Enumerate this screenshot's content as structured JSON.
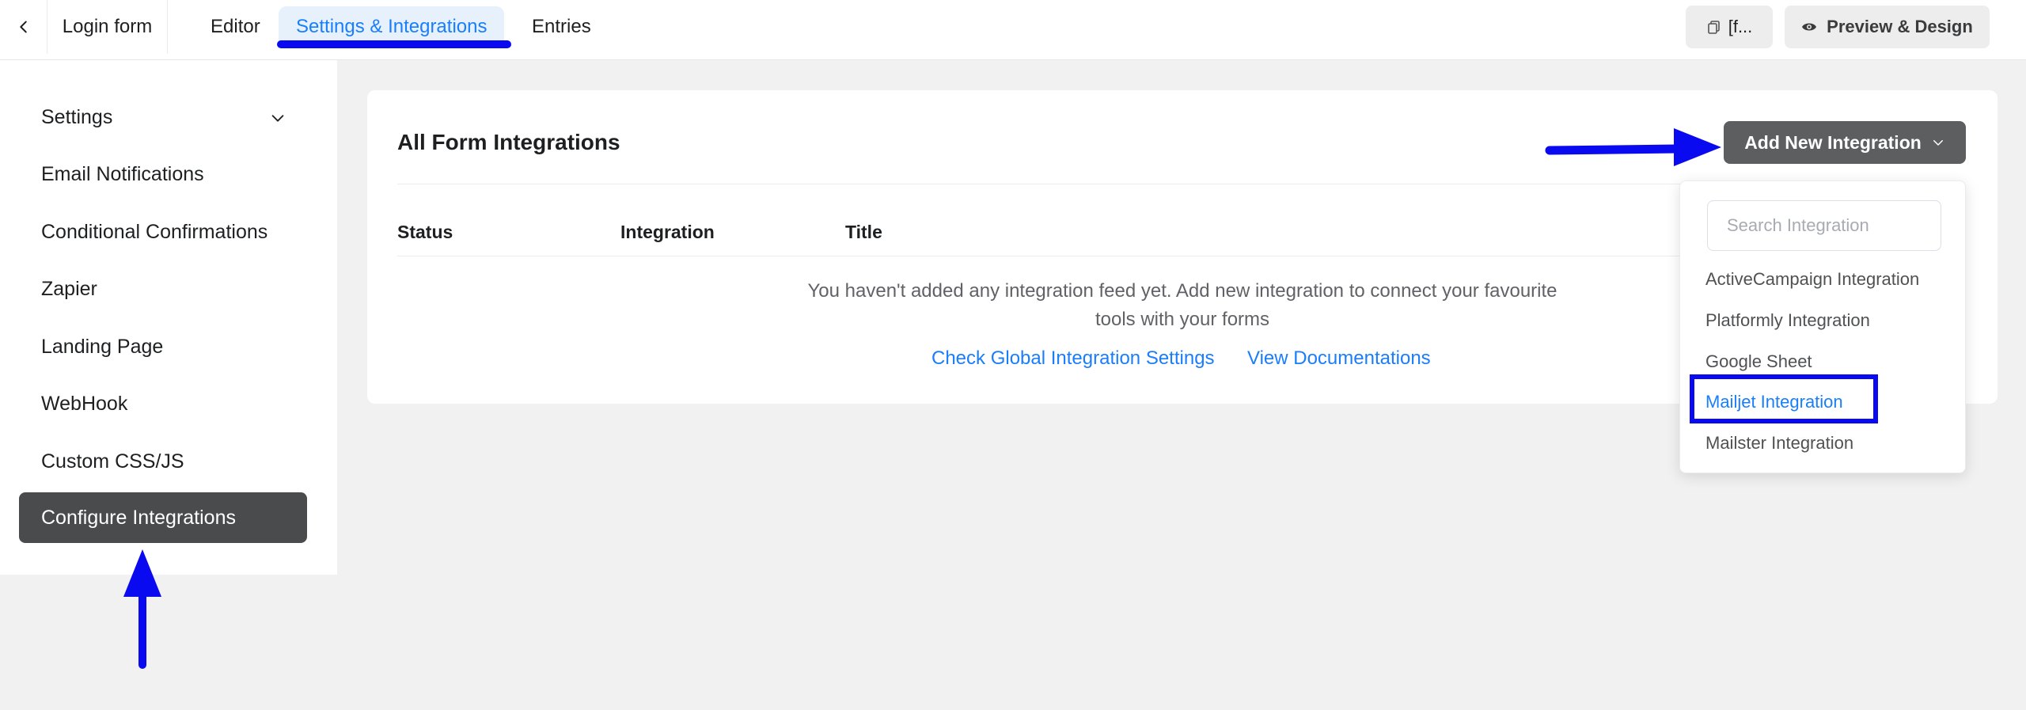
{
  "topbar": {
    "back_icon": "chevron-left-icon",
    "form_title": "Login form",
    "tabs": [
      {
        "label": "Editor"
      },
      {
        "label": "Settings & Integrations",
        "active": true
      },
      {
        "label": "Entries"
      }
    ],
    "shortcode_label": "[f...",
    "shortcode_icon": "copy-icon",
    "preview_label": "Preview & Design",
    "preview_icon": "eye-icon"
  },
  "sidebar": {
    "items": [
      {
        "label": "Settings",
        "has_chevron": true
      },
      {
        "label": "Email Notifications"
      },
      {
        "label": "Conditional Confirmations"
      },
      {
        "label": "Zapier"
      },
      {
        "label": "Landing Page"
      },
      {
        "label": "WebHook"
      },
      {
        "label": "Custom CSS/JS"
      },
      {
        "label": "Configure Integrations",
        "active": true
      }
    ]
  },
  "main": {
    "title": "All Form Integrations",
    "add_button_label": "Add New Integration",
    "columns": [
      "Status",
      "Integration",
      "Title"
    ],
    "empty_message": "You haven't added any integration feed yet. Add new integration to connect your favourite tools with your forms",
    "links": {
      "global_settings": "Check Global Integration Settings",
      "docs": "View Documentations"
    }
  },
  "dropdown": {
    "search_placeholder": "Search Integration",
    "items": [
      {
        "label": "ActiveCampaign Integration"
      },
      {
        "label": "Platformly Integration"
      },
      {
        "label": "Google Sheet"
      },
      {
        "label": "Mailjet Integration",
        "highlighted": true
      },
      {
        "label": "Mailster Integration"
      }
    ]
  },
  "colors": {
    "accent": "#1a7efb",
    "annotation": "#0a0af0",
    "active_sidebar": "#4a4b4d",
    "add_button": "#5d5e60"
  }
}
